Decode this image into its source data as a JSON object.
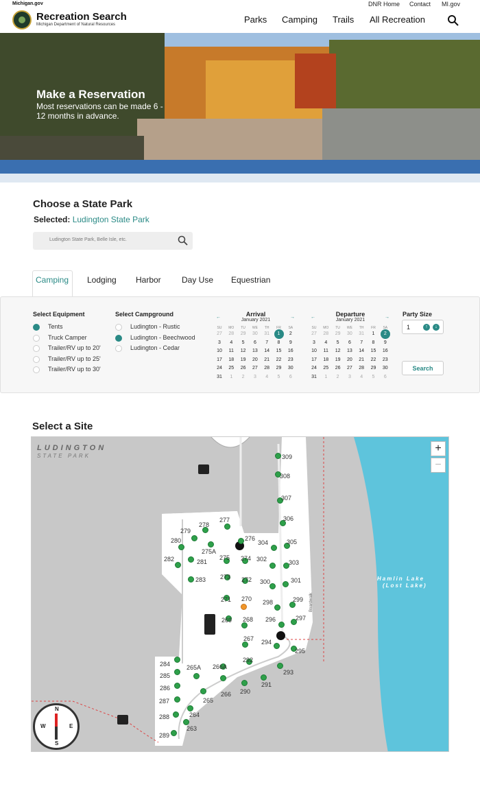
{
  "topbar": {
    "site": "Michigan.gov",
    "links": [
      "DNR Home",
      "Contact",
      "MI.gov"
    ]
  },
  "header": {
    "title": "Recreation Search",
    "subtitle": "Michigan Department of Natural Resources",
    "nav": [
      "Parks",
      "Camping",
      "Trails",
      "All Recreation"
    ]
  },
  "hero": {
    "title": "Make a Reservation",
    "subtitle": "Most reservations can be made 6 - 12 months in advance."
  },
  "park": {
    "heading": "Choose a State Park",
    "selected_label": "Selected:",
    "selected_value": "Ludington State Park",
    "search_placeholder": "Ludington State Park, Belle Isle, etc."
  },
  "tabs": [
    "Camping",
    "Lodging",
    "Harbor",
    "Day Use",
    "Equestrian"
  ],
  "equipment": {
    "label": "Select Equipment",
    "options": [
      "Tents",
      "Truck Camper",
      "Trailer/RV up to 20'",
      "Trailer/RV up to 25'",
      "Trailer/RV up to 30'"
    ],
    "selected": "Tents"
  },
  "campground": {
    "label": "Select Campground",
    "options": [
      "Ludington - Rustic",
      "Ludington - Beechwood",
      "Ludington - Cedar"
    ],
    "selected": "Ludington - Beechwood"
  },
  "arrival": {
    "label": "Arrival",
    "month": "January 2021",
    "selected_day": "1"
  },
  "departure": {
    "label": "Departure",
    "month": "January 2021",
    "selected_day": "2"
  },
  "calendar": {
    "dow": [
      "SU",
      "MO",
      "TU",
      "WE",
      "TH",
      "FR",
      "SA"
    ],
    "weeks": [
      [
        "27",
        "28",
        "29",
        "30",
        "31",
        "1",
        "2"
      ],
      [
        "3",
        "4",
        "5",
        "6",
        "7",
        "8",
        "9"
      ],
      [
        "10",
        "11",
        "12",
        "13",
        "14",
        "15",
        "16"
      ],
      [
        "17",
        "18",
        "19",
        "20",
        "21",
        "22",
        "23"
      ],
      [
        "24",
        "25",
        "26",
        "27",
        "28",
        "29",
        "30"
      ],
      [
        "31",
        "1",
        "2",
        "3",
        "4",
        "5",
        "6"
      ]
    ],
    "prev_icon": "arrow-left-icon",
    "next_icon": "arrow-right-icon"
  },
  "party": {
    "label": "Party Size",
    "value": "1"
  },
  "search_button": "Search",
  "map": {
    "heading": "Select a Site",
    "park_label": "LUDINGTON",
    "park_sublabel": "STATE PARK",
    "lake_label": "Hamlin Lake",
    "lake_sublabel": "(Lost Lake)",
    "boardwalk": "Boardwalk",
    "zoom_in": "+",
    "zoom_out": "−",
    "compass": [
      "N",
      "S",
      "E",
      "W"
    ],
    "sites": [
      {
        "n": "309",
        "c": "green"
      },
      {
        "n": "308",
        "c": "green"
      },
      {
        "n": "307",
        "c": "green"
      },
      {
        "n": "306",
        "c": "green"
      },
      {
        "n": "305",
        "c": "green"
      },
      {
        "n": "304",
        "c": "green"
      },
      {
        "n": "303",
        "c": "green"
      },
      {
        "n": "302",
        "c": "green"
      },
      {
        "n": "301",
        "c": "green"
      },
      {
        "n": "300",
        "c": "green"
      },
      {
        "n": "299",
        "c": "green"
      },
      {
        "n": "298",
        "c": "green"
      },
      {
        "n": "297",
        "c": "green"
      },
      {
        "n": "296",
        "c": "green"
      },
      {
        "n": "295",
        "c": "green"
      },
      {
        "n": "294",
        "c": "green"
      },
      {
        "n": "293",
        "c": "green"
      },
      {
        "n": "292",
        "c": "green"
      },
      {
        "n": "291",
        "c": "green"
      },
      {
        "n": "290",
        "c": "green"
      },
      {
        "n": "289",
        "c": "green"
      },
      {
        "n": "288",
        "c": "green"
      },
      {
        "n": "287",
        "c": "green"
      },
      {
        "n": "286",
        "c": "green"
      },
      {
        "n": "285",
        "c": "green"
      },
      {
        "n": "284",
        "c": "green"
      },
      {
        "n": "283",
        "c": "green"
      },
      {
        "n": "282",
        "c": "green"
      },
      {
        "n": "281",
        "c": "green"
      },
      {
        "n": "280",
        "c": "green"
      },
      {
        "n": "279",
        "c": "green"
      },
      {
        "n": "278",
        "c": "green"
      },
      {
        "n": "277",
        "c": "green"
      },
      {
        "n": "276",
        "c": "green"
      },
      {
        "n": "275A",
        "c": "green"
      },
      {
        "n": "275",
        "c": "green"
      },
      {
        "n": "274",
        "c": "green"
      },
      {
        "n": "273",
        "c": "green"
      },
      {
        "n": "272",
        "c": "green"
      },
      {
        "n": "271",
        "c": "green"
      },
      {
        "n": "270",
        "c": "orange"
      },
      {
        "n": "269",
        "c": "green"
      },
      {
        "n": "268",
        "c": "green"
      },
      {
        "n": "267",
        "c": "green"
      },
      {
        "n": "266",
        "c": "green"
      },
      {
        "n": "266A",
        "c": "green"
      },
      {
        "n": "265",
        "c": "green"
      },
      {
        "n": "265A",
        "c": "green"
      },
      {
        "n": "264",
        "c": "green"
      },
      {
        "n": "263",
        "c": "green"
      }
    ]
  }
}
